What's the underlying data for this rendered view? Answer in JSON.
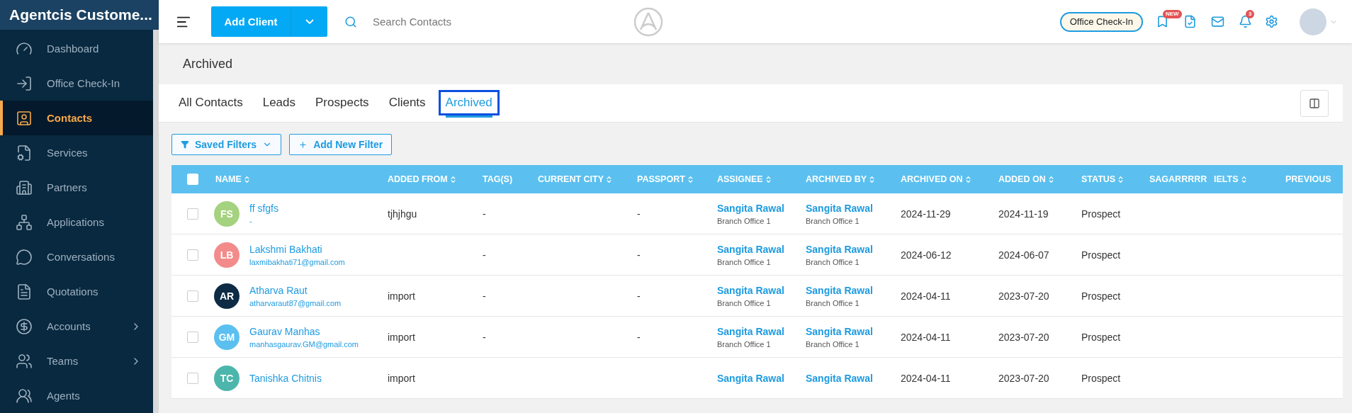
{
  "app": {
    "title": "Agentcis Custome..."
  },
  "sidebar": {
    "items": [
      {
        "label": "Dashboard",
        "selected": false,
        "expandable": false
      },
      {
        "label": "Office Check-In",
        "selected": false,
        "expandable": false
      },
      {
        "label": "Contacts",
        "selected": true,
        "expandable": false
      },
      {
        "label": "Services",
        "selected": false,
        "expandable": false
      },
      {
        "label": "Partners",
        "selected": false,
        "expandable": false
      },
      {
        "label": "Applications",
        "selected": false,
        "expandable": false
      },
      {
        "label": "Conversations",
        "selected": false,
        "expandable": false
      },
      {
        "label": "Quotations",
        "selected": false,
        "expandable": false
      },
      {
        "label": "Accounts",
        "selected": false,
        "expandable": true
      },
      {
        "label": "Teams",
        "selected": false,
        "expandable": true
      },
      {
        "label": "Agents",
        "selected": false,
        "expandable": false
      }
    ]
  },
  "topbar": {
    "add_button": "Add Client",
    "search": {
      "placeholder": "Search Contacts"
    },
    "check_in_button": "Office Check-In",
    "new_badge": "NEW",
    "notification_count": "3"
  },
  "page": {
    "title": "Archived"
  },
  "tabs": [
    {
      "label": "All Contacts",
      "selected": false
    },
    {
      "label": "Leads",
      "selected": false
    },
    {
      "label": "Prospects",
      "selected": false
    },
    {
      "label": "Clients",
      "selected": false
    },
    {
      "label": "Archived",
      "selected": true
    }
  ],
  "filters": {
    "saved": "Saved Filters",
    "add": "Add New Filter"
  },
  "table": {
    "select_all": {
      "checked": false
    },
    "columns": [
      {
        "label": "NAME",
        "sortable": true
      },
      {
        "label": "ADDED FROM",
        "sortable": true
      },
      {
        "label": "TAG(S)",
        "sortable": false
      },
      {
        "label": "CURRENT CITY",
        "sortable": true
      },
      {
        "label": "PASSPORT",
        "sortable": true
      },
      {
        "label": "ASSIGNEE",
        "sortable": true
      },
      {
        "label": "ARCHIVED BY",
        "sortable": true
      },
      {
        "label": "ARCHIVED ON",
        "sortable": true
      },
      {
        "label": "ADDED ON",
        "sortable": true
      },
      {
        "label": "STATUS",
        "sortable": true
      },
      {
        "label": "SAGARRRRR",
        "sortable": false
      },
      {
        "label": "IELTS",
        "sortable": true
      },
      {
        "label": "PREVIOUS",
        "sortable": false
      }
    ],
    "rows": [
      {
        "checked": false,
        "initials": "FS",
        "color": "#a5d27f",
        "name": "ff sfgfs",
        "email": "-",
        "added_from": "tjhjhgu",
        "tags": "-",
        "passport": "-",
        "assignee": {
          "name": "Sangita Rawal",
          "branch": "Branch Office 1"
        },
        "archived_by": {
          "name": "Sangita Rawal",
          "branch": "Branch Office 1"
        },
        "archived_on": "2024-11-29",
        "added_on": "2024-11-19",
        "status": "Prospect"
      },
      {
        "checked": false,
        "initials": "LB",
        "color": "#f38b8b",
        "name": "Lakshmi Bakhati",
        "email": "laxmibakhati71@gmail.com",
        "tags": "-",
        "passport": "-",
        "assignee": {
          "name": "Sangita Rawal",
          "branch": "Branch Office 1"
        },
        "archived_by": {
          "name": "Sangita Rawal",
          "branch": "Branch Office 1"
        },
        "archived_on": "2024-06-12",
        "added_on": "2024-06-07",
        "status": "Prospect"
      },
      {
        "checked": false,
        "initials": "AR",
        "color": "#0d2b45",
        "name": "Atharva Raut",
        "email": "atharvaraut87@gmail.com",
        "added_from": "import",
        "tags": "-",
        "passport": "-",
        "assignee": {
          "name": "Sangita Rawal",
          "branch": "Branch Office 1"
        },
        "archived_by": {
          "name": "Sangita Rawal",
          "branch": "Branch Office 1"
        },
        "archived_on": "2024-04-11",
        "added_on": "2023-07-20",
        "status": "Prospect"
      },
      {
        "checked": false,
        "initials": "GM",
        "color": "#5bc0ef",
        "name": "Gaurav Manhas",
        "email": "manhasgaurav.GM@gmail.com",
        "added_from": "import",
        "tags": "-",
        "passport": "-",
        "assignee": {
          "name": "Sangita Rawal",
          "branch": "Branch Office 1"
        },
        "archived_by": {
          "name": "Sangita Rawal",
          "branch": "Branch Office 1"
        },
        "archived_on": "2024-04-11",
        "added_on": "2023-07-20",
        "status": "Prospect"
      },
      {
        "checked": false,
        "initials": "TC",
        "color": "#4db6ac",
        "name": "Tanishka Chitnis",
        "added_from": "import",
        "assignee": {
          "name": "Sangita Rawal"
        },
        "archived_by": {
          "name": "Sangita Rawal"
        },
        "archived_on": "2024-04-11",
        "added_on": "2023-07-20",
        "status": "Prospect"
      }
    ]
  }
}
